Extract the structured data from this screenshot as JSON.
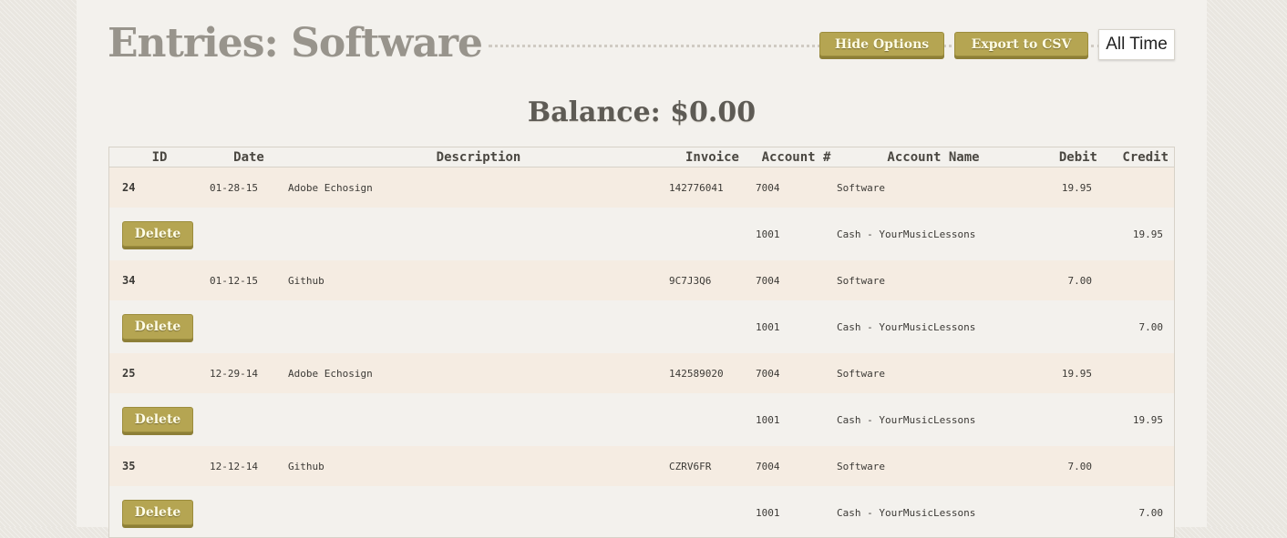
{
  "title": "Entries: Software",
  "buttons": {
    "hide_options": "Hide Options",
    "export_csv": "Export to CSV"
  },
  "range_select": {
    "selected": "All Time"
  },
  "balance": "Balance: $0.00",
  "table": {
    "headers": [
      "ID",
      "Date",
      "Description",
      "Invoice",
      "Account #",
      "Account Name",
      "Debit",
      "Credit"
    ],
    "delete_label": "Delete",
    "entries": [
      {
        "id": "24",
        "date": "01-28-15",
        "description": "Adobe Echosign",
        "invoice": "142776041",
        "debit_account": "7004",
        "debit_account_name": "Software",
        "debit": "19.95",
        "credit_account": "1001",
        "credit_account_name": "Cash - YourMusicLessons",
        "credit": "19.95"
      },
      {
        "id": "34",
        "date": "01-12-15",
        "description": "Github",
        "invoice": "9C7J3Q6",
        "debit_account": "7004",
        "debit_account_name": "Software",
        "debit": "7.00",
        "credit_account": "1001",
        "credit_account_name": "Cash - YourMusicLessons",
        "credit": "7.00"
      },
      {
        "id": "25",
        "date": "12-29-14",
        "description": "Adobe Echosign",
        "invoice": "142589020",
        "debit_account": "7004",
        "debit_account_name": "Software",
        "debit": "19.95",
        "credit_account": "1001",
        "credit_account_name": "Cash - YourMusicLessons",
        "credit": "19.95"
      },
      {
        "id": "35",
        "date": "12-12-14",
        "description": "Github",
        "invoice": "CZRV6FR",
        "debit_account": "7004",
        "debit_account_name": "Software",
        "debit": "7.00",
        "credit_account": "1001",
        "credit_account_name": "Cash - YourMusicLessons",
        "credit": "7.00"
      }
    ]
  }
}
